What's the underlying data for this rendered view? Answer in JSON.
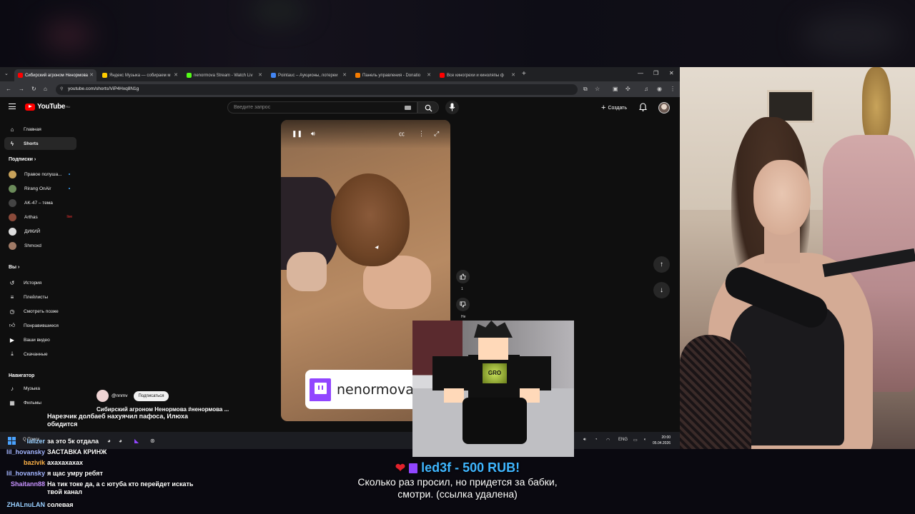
{
  "browser": {
    "tabs": [
      {
        "label": "Сибирский агроном Ненормова",
        "active": true,
        "color": "#ff0000"
      },
      {
        "label": "Яндекс Музыка — собираем м",
        "active": false,
        "color": "#ffcc00"
      },
      {
        "label": "nenormova Stream - Watch Liv",
        "active": false,
        "color": "#53fc18"
      },
      {
        "label": "Pointauc – Аукционы, лотереи",
        "active": false,
        "color": "#4285f4"
      },
      {
        "label": "Панель управления - Donatio",
        "active": false,
        "color": "#f57c00"
      },
      {
        "label": "Все киногрехи и киноляпы ф",
        "active": false,
        "color": "#ff0000"
      }
    ],
    "url": "youtube.com/shorts/ViP4Hxq8N1g"
  },
  "youtube": {
    "logo": "YouTube",
    "logo_region": "RU",
    "search_placeholder": "Введите запрос",
    "create_label": "Создать",
    "sidebar": {
      "main": [
        {
          "label": "Главная",
          "icon": "home-icon"
        },
        {
          "label": "Shorts",
          "icon": "shorts-icon",
          "active": true
        }
      ],
      "subs_header": "Подписки",
      "subs": [
        {
          "label": "Правое полуша...",
          "color": "#c8a25a",
          "dot": true
        },
        {
          "label": "Rirang OnAir",
          "color": "#6b8b5a",
          "dot": true
        },
        {
          "label": "AK-47 – тема",
          "color": "#444444"
        },
        {
          "label": "Arthas",
          "color": "#8a4a3a",
          "live": "live"
        },
        {
          "label": "ДИКИЙ",
          "color": "#dddddd"
        },
        {
          "label": "Shmoxd",
          "color": "#a07a66"
        }
      ],
      "you_header": "Вы",
      "you": [
        {
          "label": "История",
          "icon": "history-icon"
        },
        {
          "label": "Плейлисты",
          "icon": "playlist-icon"
        },
        {
          "label": "Смотреть позже",
          "icon": "clock-icon"
        },
        {
          "label": "Понравившиеся",
          "icon": "thumb-up-icon"
        },
        {
          "label": "Ваши видео",
          "icon": "video-icon"
        },
        {
          "label": "Скачанные",
          "icon": "download-icon"
        }
      ],
      "nav_header": "Навигатор",
      "nav": [
        {
          "label": "Музыка",
          "icon": "music-icon"
        },
        {
          "label": "Фильмы",
          "icon": "film-icon"
        }
      ]
    },
    "video": {
      "banner_text": "nenormova",
      "channel_name": "@nnmv",
      "subscribe_label": "Подписаться",
      "title": "Сибирский агроном Ненормова #ненормова ...",
      "likes": "1",
      "dislike_label": "Не"
    }
  },
  "taskbar": {
    "search_label": "Q Поиск",
    "lang": "ENG",
    "time": "20:00",
    "date": "05.04.2026"
  },
  "chat": [
    {
      "user": "",
      "user_color": "#8aa3ff",
      "msg": "Нарезчик долбаеб нахуячил пафоса, Илюха обидится"
    },
    {
      "user": "lalizer",
      "user_color": "#9ad0ff",
      "msg": "за это 5к отдала"
    },
    {
      "user": "lil_hovansky",
      "user_color": "#a4b6ff",
      "msg": "ЗАСТАВКА КРИНЖ"
    },
    {
      "user": "bazivik",
      "user_color": "#ffb347",
      "msg": "ахахахахах"
    },
    {
      "user": "lil_hovansky",
      "user_color": "#a4b6ff",
      "msg": "я щас умру ребят"
    },
    {
      "user": "Shaitann88",
      "user_color": "#c792ff",
      "msg": "На тик токе да, а с ютуба кто перейдет искать твой канал"
    },
    {
      "user": "ZHALnuLAN",
      "user_color": "#9ad0ff",
      "msg": "солевая"
    }
  ],
  "donation": {
    "donor_line": "led3f - 500 RUB!",
    "message_1": "Сколько раз просил, но придется за бабки,",
    "message_2": "смотри. (ссылка удалена)"
  },
  "overlay": {
    "shirt_text": "GRO"
  }
}
